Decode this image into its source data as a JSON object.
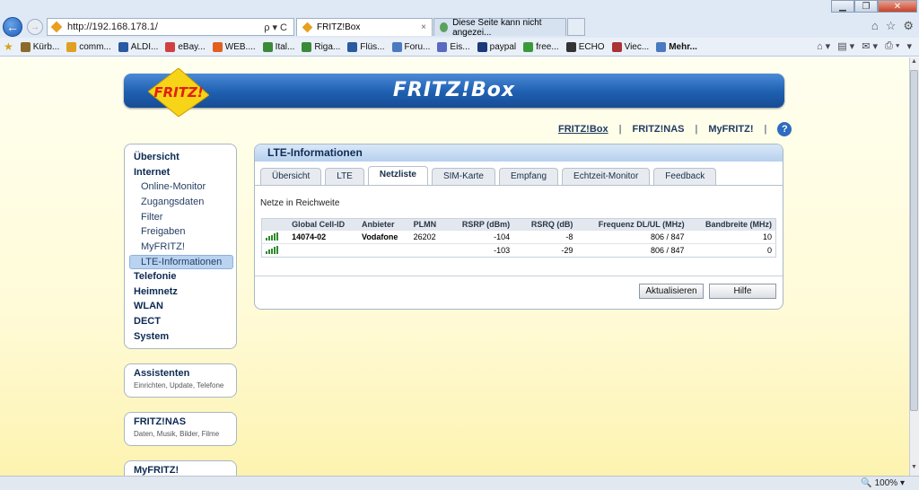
{
  "browser": {
    "address": "http://192.168.178.1/",
    "address_icons": "ρ▾C",
    "tabs": [
      {
        "label": "FRITZ!Box",
        "close": "×"
      },
      {
        "label": "Diese Seite kann nicht angezei...",
        "close": ""
      }
    ],
    "favorites": [
      {
        "label": "Kürb...",
        "color": "#8b6a2a"
      },
      {
        "label": "comm...",
        "color": "#e0a020"
      },
      {
        "label": "ALDI...",
        "color": "#2a5aa0"
      },
      {
        "label": "eBay...",
        "color": "#d04040"
      },
      {
        "label": "WEB....",
        "color": "#e06020"
      },
      {
        "label": "Ital...",
        "color": "#3a8a3a"
      },
      {
        "label": "Riga...",
        "color": "#3a8a3a"
      },
      {
        "label": "Flüs...",
        "color": "#2a5aa0"
      },
      {
        "label": "Foru...",
        "color": "#4a7ac0"
      },
      {
        "label": "Eis...",
        "color": "#5a6ac0"
      },
      {
        "label": "paypal",
        "color": "#1a3a7a"
      },
      {
        "label": "free...",
        "color": "#3a9a3a"
      },
      {
        "label": "ECHO",
        "color": "#333333"
      },
      {
        "label": "Viec...",
        "color": "#aa3333"
      },
      {
        "label": "Mehr...",
        "color": "#4a7ac0"
      }
    ],
    "zoom": "100%"
  },
  "header": {
    "brand": "FRITZ!Box",
    "logo_text": "FRITZ!"
  },
  "toplinks": [
    "FRITZ!Box",
    "FRITZ!NAS",
    "MyFRITZ!"
  ],
  "help": "?",
  "menu": [
    {
      "label": "Übersicht",
      "type": "main"
    },
    {
      "label": "Internet",
      "type": "main"
    },
    {
      "label": "Online-Monitor",
      "type": "sub"
    },
    {
      "label": "Zugangsdaten",
      "type": "sub"
    },
    {
      "label": "Filter",
      "type": "sub"
    },
    {
      "label": "Freigaben",
      "type": "sub"
    },
    {
      "label": "MyFRITZ!",
      "type": "sub"
    },
    {
      "label": "LTE-Informationen",
      "type": "sub-active"
    },
    {
      "label": "Telefonie",
      "type": "main"
    },
    {
      "label": "Heimnetz",
      "type": "main"
    },
    {
      "label": "WLAN",
      "type": "main"
    },
    {
      "label": "DECT",
      "type": "main"
    },
    {
      "label": "System",
      "type": "main"
    }
  ],
  "boxes": [
    {
      "title": "Assistenten",
      "sub": "Einrichten, Update, Telefone"
    },
    {
      "title": "FRITZ!NAS",
      "sub": "Daten, Musik, Bilder, Filme"
    },
    {
      "title": "MyFRITZ!",
      "sub": ""
    }
  ],
  "panel": {
    "title": "LTE-Informationen",
    "tabs": [
      "Übersicht",
      "LTE",
      "Netzliste",
      "SIM-Karte",
      "Empfang",
      "Echtzeit-Monitor",
      "Feedback"
    ],
    "selected_tab": 2,
    "section": "Netze in Reichweite",
    "columns": [
      "Global Cell-ID",
      "Anbieter",
      "PLMN",
      "RSRP (dBm)",
      "RSRQ (dB)",
      "Frequenz DL/UL (MHz)",
      "Bandbreite (MHz)"
    ],
    "rows": [
      {
        "signal": 5,
        "cell": "14074-02",
        "provider": "Vodafone",
        "plmn": "26202",
        "rsrp": "-104",
        "rsrq": "-8",
        "freq": "806 / 847",
        "bw": "10"
      },
      {
        "signal": 5,
        "cell": "",
        "provider": "",
        "plmn": "",
        "rsrp": "-103",
        "rsrq": "-29",
        "freq": "806 / 847",
        "bw": "0"
      }
    ],
    "buttons": {
      "refresh": "Aktualisieren",
      "help": "Hilfe"
    }
  }
}
